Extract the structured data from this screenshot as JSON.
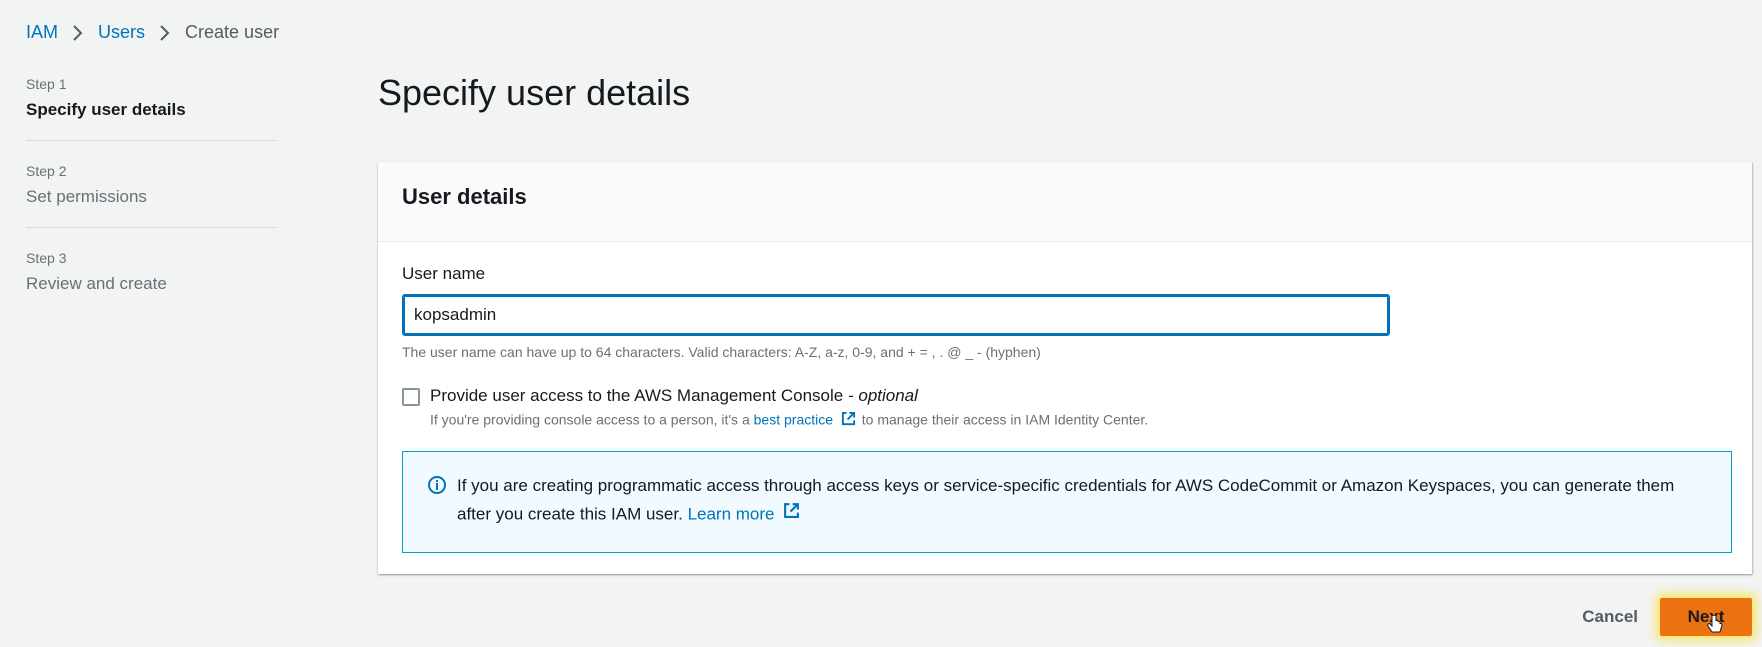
{
  "breadcrumb": {
    "items": [
      {
        "label": "IAM"
      },
      {
        "label": "Users"
      },
      {
        "label": "Create user"
      }
    ]
  },
  "steps": [
    {
      "number": "Step 1",
      "title": "Specify user details",
      "active": true
    },
    {
      "number": "Step 2",
      "title": "Set permissions",
      "active": false
    },
    {
      "number": "Step 3",
      "title": "Review and create",
      "active": false
    }
  ],
  "page_title": "Specify user details",
  "container": {
    "header": "User details",
    "user_name": {
      "label": "User name",
      "value": "kopsadmin",
      "constraint": "The user name can have up to 64 characters. Valid characters: A-Z, a-z, 0-9, and + = , . @ _ - (hyphen)"
    },
    "console_access": {
      "label": "Provide user access to the AWS Management Console",
      "optional": "- optional",
      "checked": false,
      "desc_prefix": "If you're providing console access to a person, it's a",
      "desc_link": "best practice",
      "desc_suffix": "to manage their access in IAM Identity Center."
    },
    "info_alert": {
      "text": "If you are creating programmatic access through access keys or service-specific credentials for AWS CodeCommit or Amazon Keyspaces, you can generate them after you create this IAM user.",
      "link": "Learn more"
    }
  },
  "actions": {
    "cancel_label": "Cancel",
    "next_label": "Next"
  },
  "colors": {
    "link": "#0073bb",
    "primary_button": "#ec7211",
    "info_border": "#00a1c9",
    "info_bg": "#f1faff"
  }
}
